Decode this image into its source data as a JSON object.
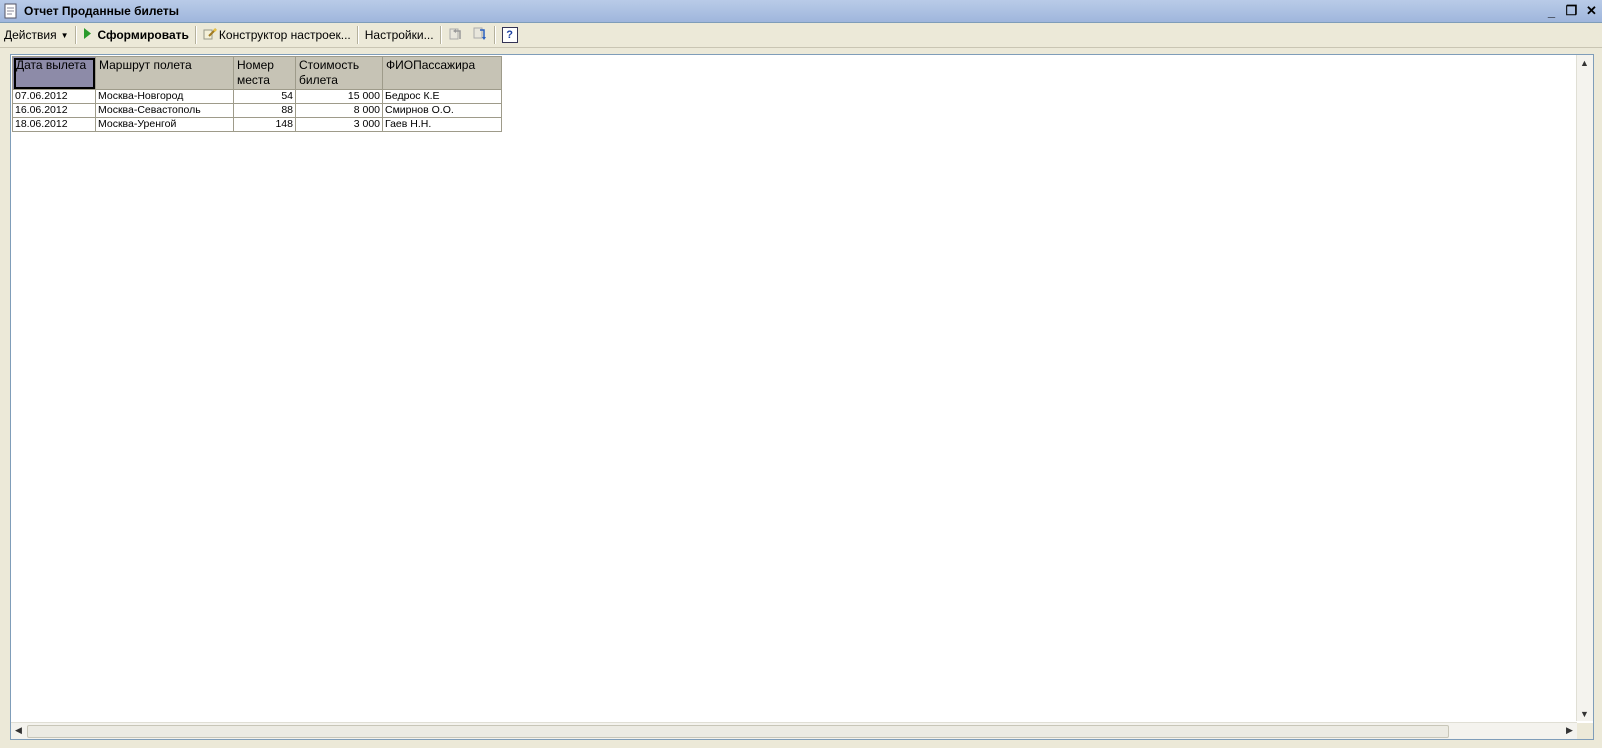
{
  "window": {
    "title": "Отчет  Проданные билеты",
    "controls": [
      "_",
      "❐",
      "✕"
    ]
  },
  "toolbar": {
    "actions_label": "Действия",
    "generate_label": "Сформировать",
    "constructor_label": "Конструктор настроек...",
    "settings_label": "Настройки...",
    "help_label": "?"
  },
  "table": {
    "headers": [
      "Дата вылета",
      "Маршрут полета",
      "Номер места",
      "Стоимость билета",
      "ФИОПассажира"
    ],
    "rows": [
      [
        "07.06.2012",
        "Москва-Новгород",
        "54",
        "15 000",
        "Бедрос К.Е"
      ],
      [
        "16.06.2012",
        "Москва-Севастополь",
        "88",
        "8 000",
        "Смирнов О.О."
      ],
      [
        "18.06.2012",
        "Москва-Уренгой",
        "148",
        "3 000",
        "Гаев Н.Н."
      ]
    ]
  },
  "colors": {
    "titlebar": "#9fb6dc",
    "header": "#c6c3b5",
    "selected_header": "#8d8ba8",
    "generate_icon": "#2a9a2a"
  }
}
